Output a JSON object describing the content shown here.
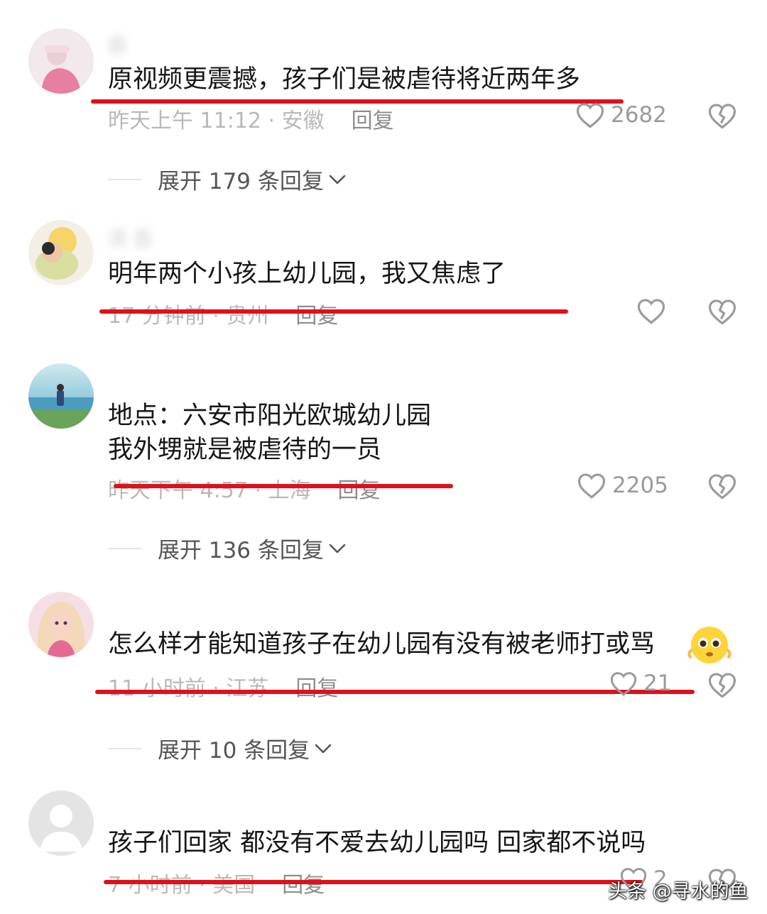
{
  "comments": [
    {
      "username": "香",
      "text": "原视频更震撼，孩子们是被虐待将近两年多",
      "time": "昨天上午 11:12 · 安徽",
      "reply": "回复",
      "likes": "2682",
      "expand": "展开 179 条回复"
    },
    {
      "username": "清香",
      "text": "明年两个小孩上幼儿园，我又焦虑了",
      "time": "17 分钟前 · 贵州",
      "reply": "回复",
      "likes": ""
    },
    {
      "username": "",
      "text_line1": "地点：六安市阳光欧城幼儿园",
      "text_line2": "我外甥就是被虐待的一员",
      "time": "昨天下午 4:57 · 上海",
      "reply": "回复",
      "likes": "2205",
      "expand": "展开 136 条回复"
    },
    {
      "username": "",
      "text": "怎么样才能知道孩子在幼儿园有没有被老师打或骂",
      "time": "11 小时前 · 江苏",
      "reply": "回复",
      "likes": "21",
      "expand": "展开 10 条回复"
    },
    {
      "username": "",
      "text": "孩子们回家 都没有不爱去幼儿园吗 回家都不说吗",
      "time": "7 小时前 · 美国",
      "reply": "回复",
      "likes": "2"
    }
  ],
  "watermark": "头条 @寻水的鱼",
  "colors": {
    "underline": "#e0101a",
    "meta": "#b9b9b9",
    "text": "#161616"
  }
}
